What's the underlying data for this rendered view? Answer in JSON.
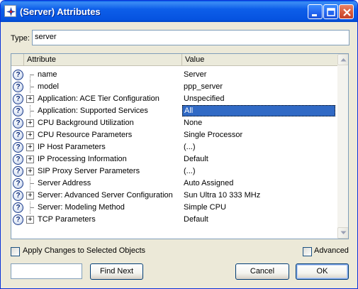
{
  "window": {
    "title": "(Server) Attributes",
    "icon": "opnet-star-icon",
    "controls": [
      "minimize",
      "maximize",
      "close"
    ]
  },
  "type_field": {
    "label": "Type:",
    "value": "server"
  },
  "grid": {
    "columns": {
      "attribute": "Attribute",
      "value": "Value"
    },
    "rows": [
      {
        "attribute": "name",
        "value": "Server",
        "expandable": false,
        "tree": "first"
      },
      {
        "attribute": "model",
        "value": "ppp_server",
        "expandable": false,
        "tree": "mid"
      },
      {
        "attribute": "Application: ACE Tier Configuration",
        "value": "Unspecified",
        "expandable": true
      },
      {
        "attribute": "Application: Supported Services",
        "value": "All",
        "expandable": false,
        "tree": "mid",
        "selected": true
      },
      {
        "attribute": "CPU Background Utilization",
        "value": "None",
        "expandable": true
      },
      {
        "attribute": "CPU Resource Parameters",
        "value": "Single Processor",
        "expandable": true
      },
      {
        "attribute": "IP Host Parameters",
        "value": "(...)",
        "expandable": true
      },
      {
        "attribute": "IP Processing Information",
        "value": "Default",
        "expandable": true
      },
      {
        "attribute": "SIP Proxy Server Parameters",
        "value": "(...)",
        "expandable": true
      },
      {
        "attribute": "Server Address",
        "value": "Auto Assigned",
        "expandable": false,
        "tree": "mid"
      },
      {
        "attribute": "Server: Advanced Server Configuration",
        "value": "Sun Ultra 10 333 MHz",
        "expandable": true
      },
      {
        "attribute": "Server: Modeling Method",
        "value": "Simple CPU",
        "expandable": false,
        "tree": "mid"
      },
      {
        "attribute": "TCP Parameters",
        "value": "Default",
        "expandable": true
      }
    ]
  },
  "apply_changes": {
    "label": "Apply Changes to Selected Objects",
    "checked": false
  },
  "advanced": {
    "label": "Advanced",
    "checked": false
  },
  "find": {
    "value": "",
    "button_label": "Find Next"
  },
  "buttons": {
    "cancel": "Cancel",
    "ok": "OK"
  },
  "colors": {
    "titlebar": "#0653e0",
    "selection": "#316ac5",
    "dialog_bg": "#ece9d8"
  }
}
